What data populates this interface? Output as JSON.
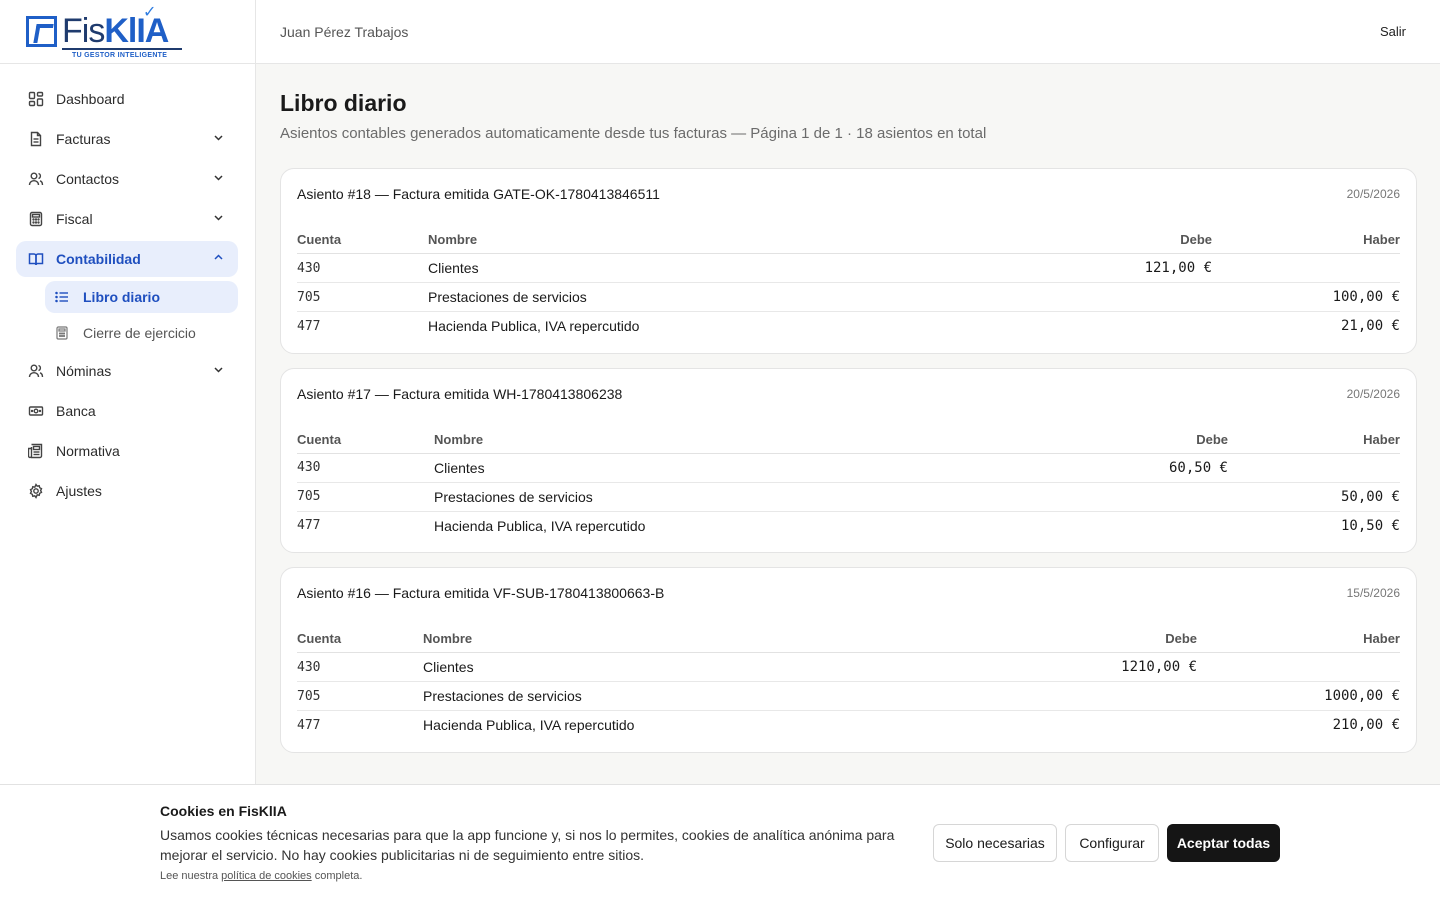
{
  "brand": {
    "name_part1": "Fis",
    "name_part2": "KlIA",
    "tagline": "TU GESTOR INTELIGENTE"
  },
  "header": {
    "company": "Juan Pérez Trabajos",
    "logout_label": "Salir"
  },
  "sidebar": {
    "items": [
      {
        "label": "Dashboard",
        "icon": "dashboard-icon"
      },
      {
        "label": "Facturas",
        "icon": "file-icon",
        "expandable": true
      },
      {
        "label": "Contactos",
        "icon": "users-icon",
        "expandable": true
      },
      {
        "label": "Fiscal",
        "icon": "calculator-icon",
        "expandable": true
      },
      {
        "label": "Contabilidad",
        "icon": "book-icon",
        "expandable": true,
        "expanded": true,
        "active": true
      },
      {
        "label": "Nóminas",
        "icon": "users-icon",
        "expandable": true
      },
      {
        "label": "Banca",
        "icon": "banknote-icon"
      },
      {
        "label": "Normativa",
        "icon": "newspaper-icon"
      },
      {
        "label": "Ajustes",
        "icon": "gear-icon"
      }
    ],
    "subitems": [
      {
        "label": "Libro diario",
        "icon": "list-icon",
        "active": true
      },
      {
        "label": "Cierre de ejercicio",
        "icon": "calculator-icon"
      }
    ]
  },
  "main": {
    "title": "Libro diario",
    "subtitle": "Asientos contables generados automaticamente desde tus facturas — Página 1 de 1 · 18 asientos en total",
    "columns": {
      "account": "Cuenta",
      "name": "Nombre",
      "debit": "Debe",
      "credit": "Haber"
    },
    "entries": [
      {
        "title": "Asiento #18 — Factura emitida GATE-OK-1780413846511",
        "date": "20/5/2026",
        "lines": [
          {
            "account": "430",
            "name": "Clientes",
            "debit": "121,00 €",
            "credit": ""
          },
          {
            "account": "705",
            "name": "Prestaciones de servicios",
            "debit": "",
            "credit": "100,00 €"
          },
          {
            "account": "477",
            "name": "Hacienda Publica, IVA repercutido",
            "debit": "",
            "credit": "21,00 €"
          }
        ]
      },
      {
        "title": "Asiento #17 — Factura emitida WH-1780413806238",
        "date": "20/5/2026",
        "lines": [
          {
            "account": "430",
            "name": "Clientes",
            "debit": "60,50 €",
            "credit": ""
          },
          {
            "account": "705",
            "name": "Prestaciones de servicios",
            "debit": "",
            "credit": "50,00 €"
          },
          {
            "account": "477",
            "name": "Hacienda Publica, IVA repercutido",
            "debit": "",
            "credit": "10,50 €"
          }
        ]
      },
      {
        "title": "Asiento #16 — Factura emitida VF-SUB-1780413800663-B",
        "date": "15/5/2026",
        "lines": [
          {
            "account": "430",
            "name": "Clientes",
            "debit": "1210,00 €",
            "credit": ""
          },
          {
            "account": "705",
            "name": "Prestaciones de servicios",
            "debit": "",
            "credit": "1000,00 €"
          },
          {
            "account": "477",
            "name": "Hacienda Publica, IVA repercutido",
            "debit": "",
            "credit": "210,00 €"
          }
        ]
      }
    ]
  },
  "cookies": {
    "title": "Cookies en FisKlIA",
    "text": "Usamos cookies técnicas necesarias para que la app funcione y, si nos lo permites, cookies de analítica anónima para mejorar el servicio. No hay cookies publicitarias ni de seguimiento entre sitios.",
    "link_prefix": "Lee nuestra",
    "link_text": "política de cookies",
    "link_suffix": "completa.",
    "btn_necessary": "Solo necesarias",
    "btn_configure": "Configurar",
    "btn_accept": "Aceptar todas"
  }
}
